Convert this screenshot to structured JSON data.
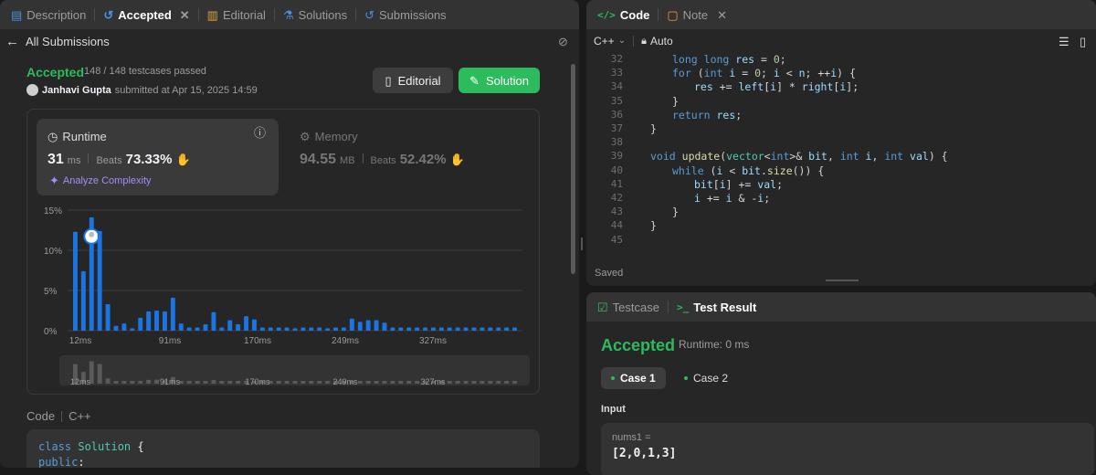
{
  "left_tabs": [
    {
      "label": "Description",
      "icon": "description-icon"
    },
    {
      "label": "Accepted",
      "icon": "history-icon",
      "active": true
    },
    {
      "label": "Editorial",
      "icon": "book-icon"
    },
    {
      "label": "Solutions",
      "icon": "flask-icon"
    },
    {
      "label": "Submissions",
      "icon": "history-icon"
    }
  ],
  "back_label": "All Submissions",
  "status": {
    "title": "Accepted",
    "testcases": "148 / 148 testcases passed",
    "author": "Janhavi Gupta",
    "submitted": "submitted at Apr 15, 2025 14:59"
  },
  "buttons": {
    "editorial": "Editorial",
    "solution": "Solution"
  },
  "runtime": {
    "label": "Runtime",
    "value": "31",
    "unit": "ms",
    "beats_label": "Beats",
    "beats": "73.33%",
    "analyze": "Analyze Complexity"
  },
  "memory": {
    "label": "Memory",
    "value": "94.55",
    "unit": "MB",
    "beats_label": "Beats",
    "beats": "52.42%"
  },
  "chart_data": {
    "type": "bar",
    "y_ticks": [
      "15%",
      "10%",
      "5%",
      "0%"
    ],
    "ylim": [
      0,
      15
    ],
    "x_ticks": [
      "12ms",
      "91ms",
      "170ms",
      "249ms",
      "327ms"
    ],
    "values": [
      12.3,
      7.4,
      14.1,
      12.4,
      3.3,
      0.6,
      0.9,
      0.3,
      1.6,
      2.4,
      2.5,
      2.4,
      4.1,
      0.9,
      0.4,
      0.4,
      0.8,
      2.3,
      0.4,
      1.3,
      0.8,
      1.8,
      1.4,
      0.4,
      0.4,
      0.4,
      0.4,
      0.3,
      0.4,
      0.4,
      0.4,
      0.3,
      0.4,
      0.4,
      1.5,
      1.1,
      1.3,
      1.3,
      1.0,
      0.4,
      0.4,
      0.4,
      0.4,
      0.4,
      0.4,
      0.4,
      0.4,
      0.4,
      0.4,
      0.4,
      0.4,
      0.4,
      0.4,
      0.4,
      0.4
    ],
    "highlight_index": 2,
    "grid": true,
    "mini_ticks": [
      "12ms",
      "91ms",
      "170ms",
      "249ms",
      "327ms"
    ]
  },
  "code_section": {
    "label": "Code",
    "lang": "C++",
    "lines": [
      "class Solution {",
      "public:"
    ]
  },
  "right_tabs": [
    {
      "label": "Code",
      "icon": "code-icon",
      "active": true
    },
    {
      "label": "Note",
      "icon": "note-icon"
    }
  ],
  "editor": {
    "lang": "C++",
    "mode": "Auto",
    "saved": "Saved"
  },
  "code_lines": [
    {
      "n": "32",
      "t": "long long res = 0;"
    },
    {
      "n": "33",
      "t": "for (int i = 0; i < n; ++i) {"
    },
    {
      "n": "34",
      "t": "res += left[i] * right[i];"
    },
    {
      "n": "35",
      "t": "}"
    },
    {
      "n": "36",
      "t": "return res;"
    },
    {
      "n": "37",
      "t": "}"
    },
    {
      "n": "38",
      "t": ""
    },
    {
      "n": "39",
      "t": "void update(vector<int>& bit, int i, int val) {"
    },
    {
      "n": "40",
      "t": "while (i < bit.size()) {"
    },
    {
      "n": "41",
      "t": "bit[i] += val;"
    },
    {
      "n": "42",
      "t": "i += i & -i;"
    },
    {
      "n": "43",
      "t": "}"
    },
    {
      "n": "44",
      "t": "}"
    },
    {
      "n": "45",
      "t": ""
    }
  ],
  "result_tabs": [
    {
      "label": "Testcase",
      "icon": "check-icon"
    },
    {
      "label": "Test Result",
      "icon": "terminal-icon",
      "active": true
    }
  ],
  "result": {
    "title": "Accepted",
    "runtime": "Runtime: 0 ms",
    "case1": "Case 1",
    "case2": "Case 2",
    "input_label": "Input",
    "var_label": "nums1 =",
    "var_value": "[2,0,1,3]"
  },
  "colors": {
    "accepted": "#2cbb5d",
    "bar": "#1a74e4",
    "link": "#a78bfa"
  }
}
